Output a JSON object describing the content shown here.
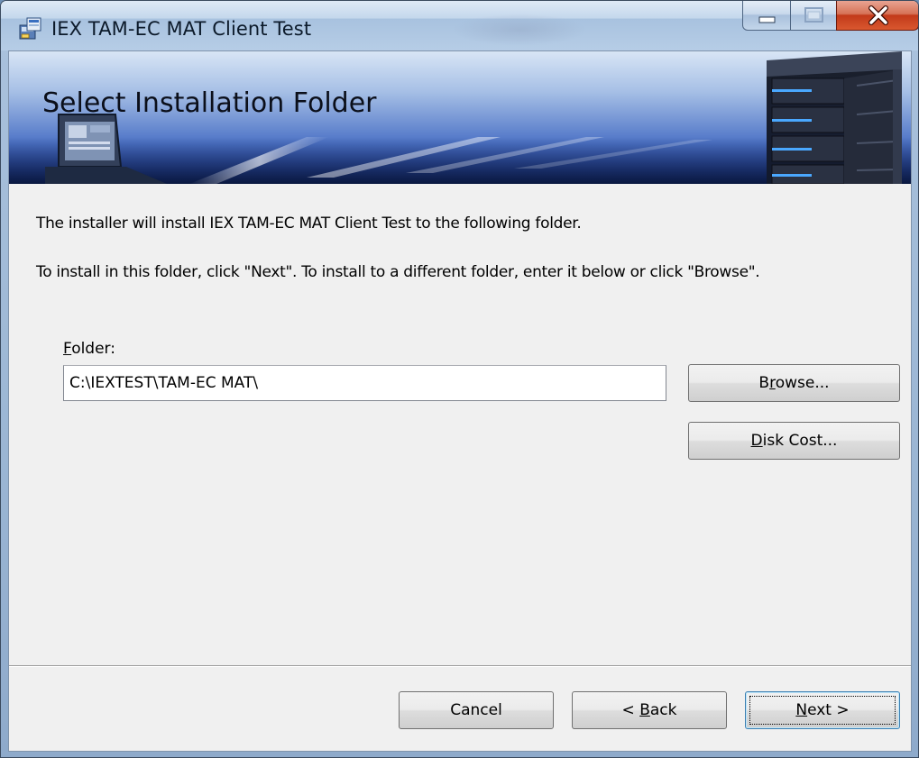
{
  "window": {
    "title": "IEX TAM-EC MAT Client Test",
    "controls": {
      "minimize": "minimize",
      "maximize": "maximize",
      "close": "close"
    }
  },
  "banner": {
    "title": "Select Installation Folder"
  },
  "body": {
    "line1": "The installer will install IEX TAM-EC MAT Client Test to the following folder.",
    "line2": "To install in this folder, click \"Next\". To install to a different folder, enter it below or click \"Browse\"."
  },
  "folder": {
    "label_mnemonic": "F",
    "label_rest": "older:",
    "value": "C:\\IEXTEST\\TAM-EC MAT\\"
  },
  "buttons": {
    "browse": {
      "pre": "B",
      "mnemonic": "r",
      "post": "owse..."
    },
    "disk_cost": {
      "pre": "",
      "mnemonic": "D",
      "post": "isk Cost..."
    },
    "cancel": "Cancel",
    "back": {
      "pre": "< ",
      "mnemonic": "B",
      "post": "ack"
    },
    "next": {
      "pre": "",
      "mnemonic": "N",
      "post": "ext >"
    }
  },
  "colors": {
    "close_button": "#c2391a",
    "banner_blue": "#1d3c99",
    "client_bg": "#f0f0f0"
  }
}
